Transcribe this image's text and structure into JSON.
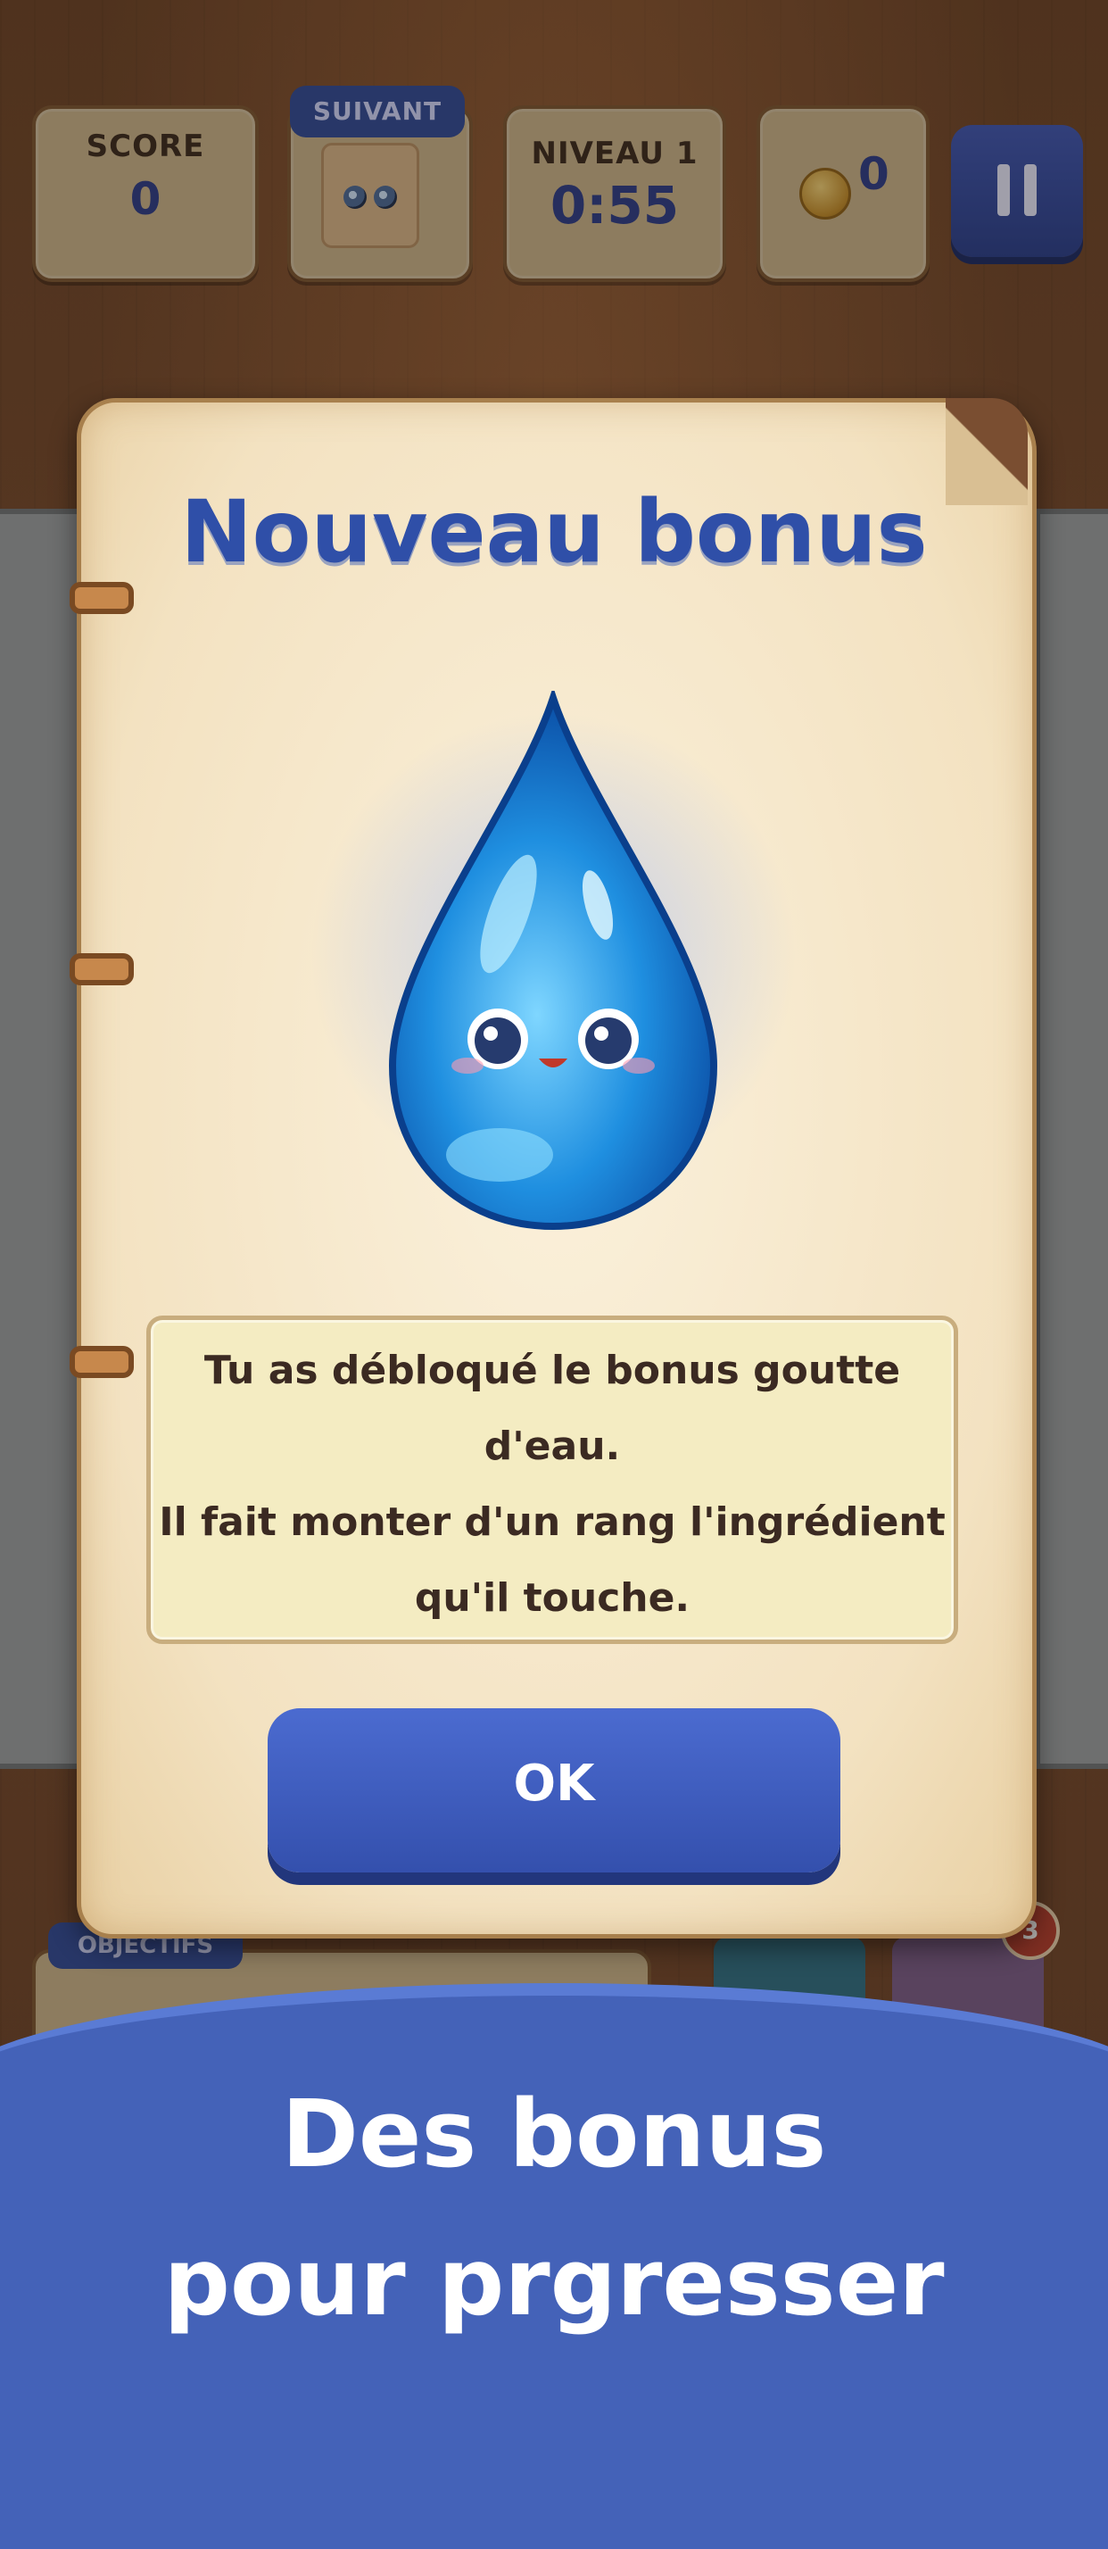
{
  "hud": {
    "score_label": "SCORE",
    "score_value": "0",
    "next_label": "SUIVANT",
    "level_label": "NIVEAU 1",
    "timer": "0:55",
    "coins": "0"
  },
  "bottom": {
    "objectives_label": "OBJECTIFS",
    "badge_count": "3"
  },
  "modal": {
    "title": "Nouveau bonus",
    "text_line1": "Tu as débloqué le bonus goutte",
    "text_line2": "d'eau.",
    "text_line3": "Il fait monter d'un rang l'ingrédient",
    "text_line4": "qu'il touche.",
    "ok_label": "OK"
  },
  "promo": {
    "line1": "Des bonus",
    "line2": "pour prgresser"
  },
  "colors": {
    "accent_blue": "#2f4fa8",
    "button_blue": "#3450ad",
    "banner_blue": "#4462b8",
    "paper": "#f3e2c1"
  },
  "icons": [
    "pause-icon",
    "coin-icon",
    "water-drop-icon",
    "bread-icon"
  ]
}
